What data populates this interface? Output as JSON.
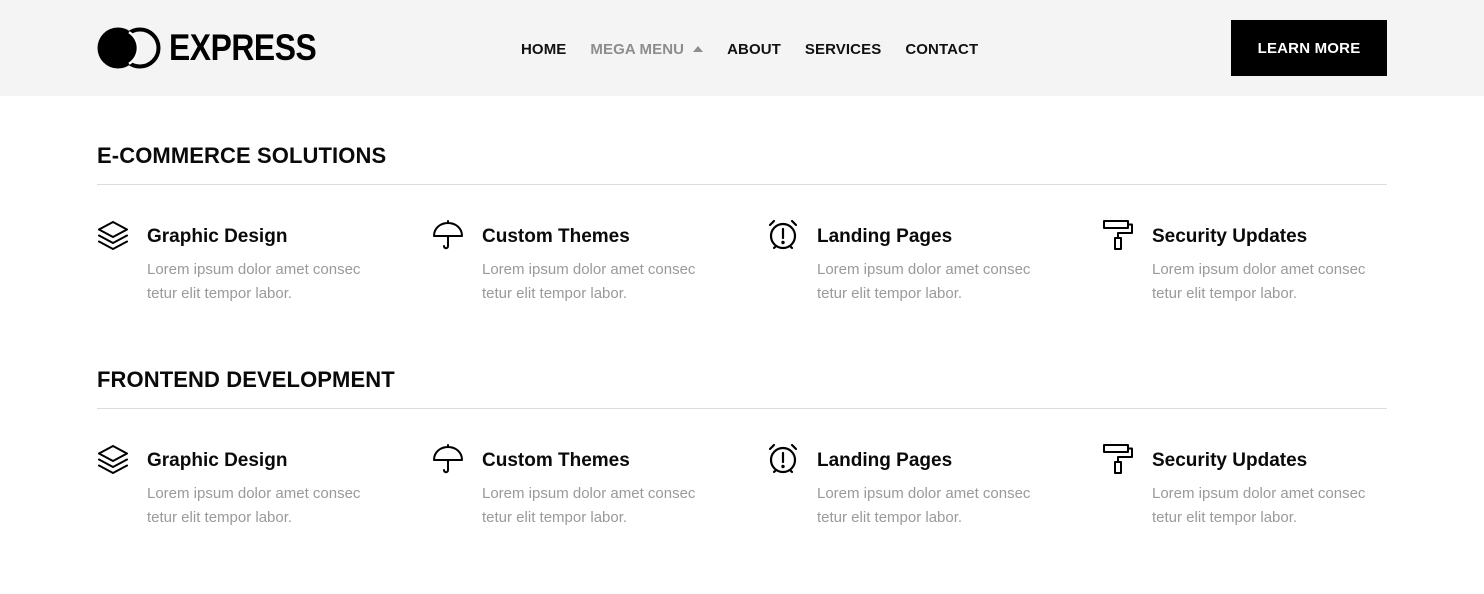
{
  "brand": {
    "name": "EXPRESS"
  },
  "nav": {
    "items": [
      {
        "label": "HOME",
        "active": false
      },
      {
        "label": "MEGA MENU",
        "active": true
      },
      {
        "label": "ABOUT",
        "active": false
      },
      {
        "label": "SERVICES",
        "active": false
      },
      {
        "label": "CONTACT",
        "active": false
      }
    ],
    "cta_label": "LEARN MORE"
  },
  "colors": {
    "header_bg": "#f4f4f4",
    "active_nav": "#8d8d8d",
    "muted_text": "#9a9a9a",
    "cta_bg": "#000000"
  },
  "mega_menu": {
    "sections": [
      {
        "title": "E-COMMERCE SOLUTIONS",
        "items": [
          {
            "icon": "layers-icon",
            "title": "Graphic Design",
            "desc_line1": "Lorem ipsum dolor amet consec",
            "desc_line2": "tetur elit tempor labor."
          },
          {
            "icon": "umbrella-icon",
            "title": "Custom Themes",
            "desc_line1": "Lorem ipsum dolor amet consec",
            "desc_line2": "tetur elit tempor labor."
          },
          {
            "icon": "alarm-clock-icon",
            "title": "Landing Pages",
            "desc_line1": "Lorem ipsum dolor amet consec",
            "desc_line2": "tetur elit tempor labor."
          },
          {
            "icon": "paint-roller-icon",
            "title": "Security Updates",
            "desc_line1": "Lorem ipsum dolor amet consec",
            "desc_line2": "tetur elit tempor labor."
          }
        ]
      },
      {
        "title": "FRONTEND DEVELOPMENT",
        "items": [
          {
            "icon": "layers-icon",
            "title": "Graphic Design",
            "desc_line1": "Lorem ipsum dolor amet consec",
            "desc_line2": "tetur elit tempor labor."
          },
          {
            "icon": "umbrella-icon",
            "title": "Custom Themes",
            "desc_line1": "Lorem ipsum dolor amet consec",
            "desc_line2": "tetur elit tempor labor."
          },
          {
            "icon": "alarm-clock-icon",
            "title": "Landing Pages",
            "desc_line1": "Lorem ipsum dolor amet consec",
            "desc_line2": "tetur elit tempor labor."
          },
          {
            "icon": "paint-roller-icon",
            "title": "Security Updates",
            "desc_line1": "Lorem ipsum dolor amet consec",
            "desc_line2": "tetur elit tempor labor."
          }
        ]
      }
    ]
  }
}
